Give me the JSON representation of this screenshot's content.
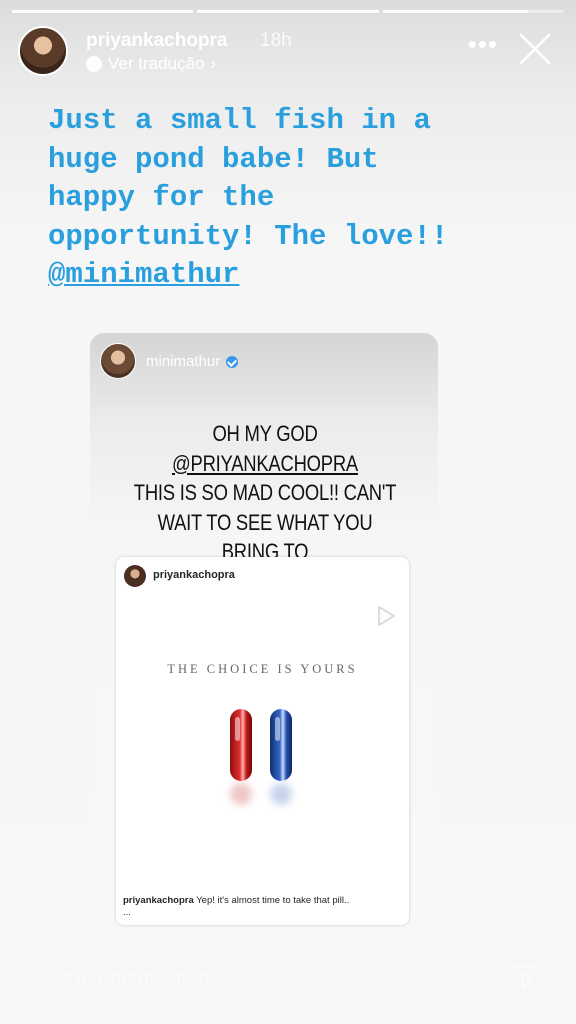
{
  "story": {
    "progress": [
      1,
      1,
      0.8
    ]
  },
  "header": {
    "username": "priyankachopra",
    "time": "18h",
    "translate_label": "Ver tradução",
    "translate_chevron": "›",
    "more": "•••"
  },
  "caption": {
    "text": "Just a small fish in a\nhuge pond babe! But\nhappy for the\nopportunity! The love!!\n",
    "mention": "@minimathur"
  },
  "card": {
    "username": "minimathur",
    "text_line1_prefix": "OH MY GOD ",
    "text_mention": "@PRIYANKACHOPRA",
    "text_rest": "THIS IS SO MAD COOL!! CAN'T\nWAIT TO SEE WHAT YOU BRING TO\nTHIS FILM!!"
  },
  "post": {
    "username": "priyankachopra",
    "tagline": "THE CHOICE IS YOURS",
    "caption_user": "priyankachopra",
    "caption_text": " Yep! it's almost time to take that pill..",
    "caption_more": "..."
  },
  "footer": {
    "reply_placeholder": "Enviar mensagem"
  }
}
